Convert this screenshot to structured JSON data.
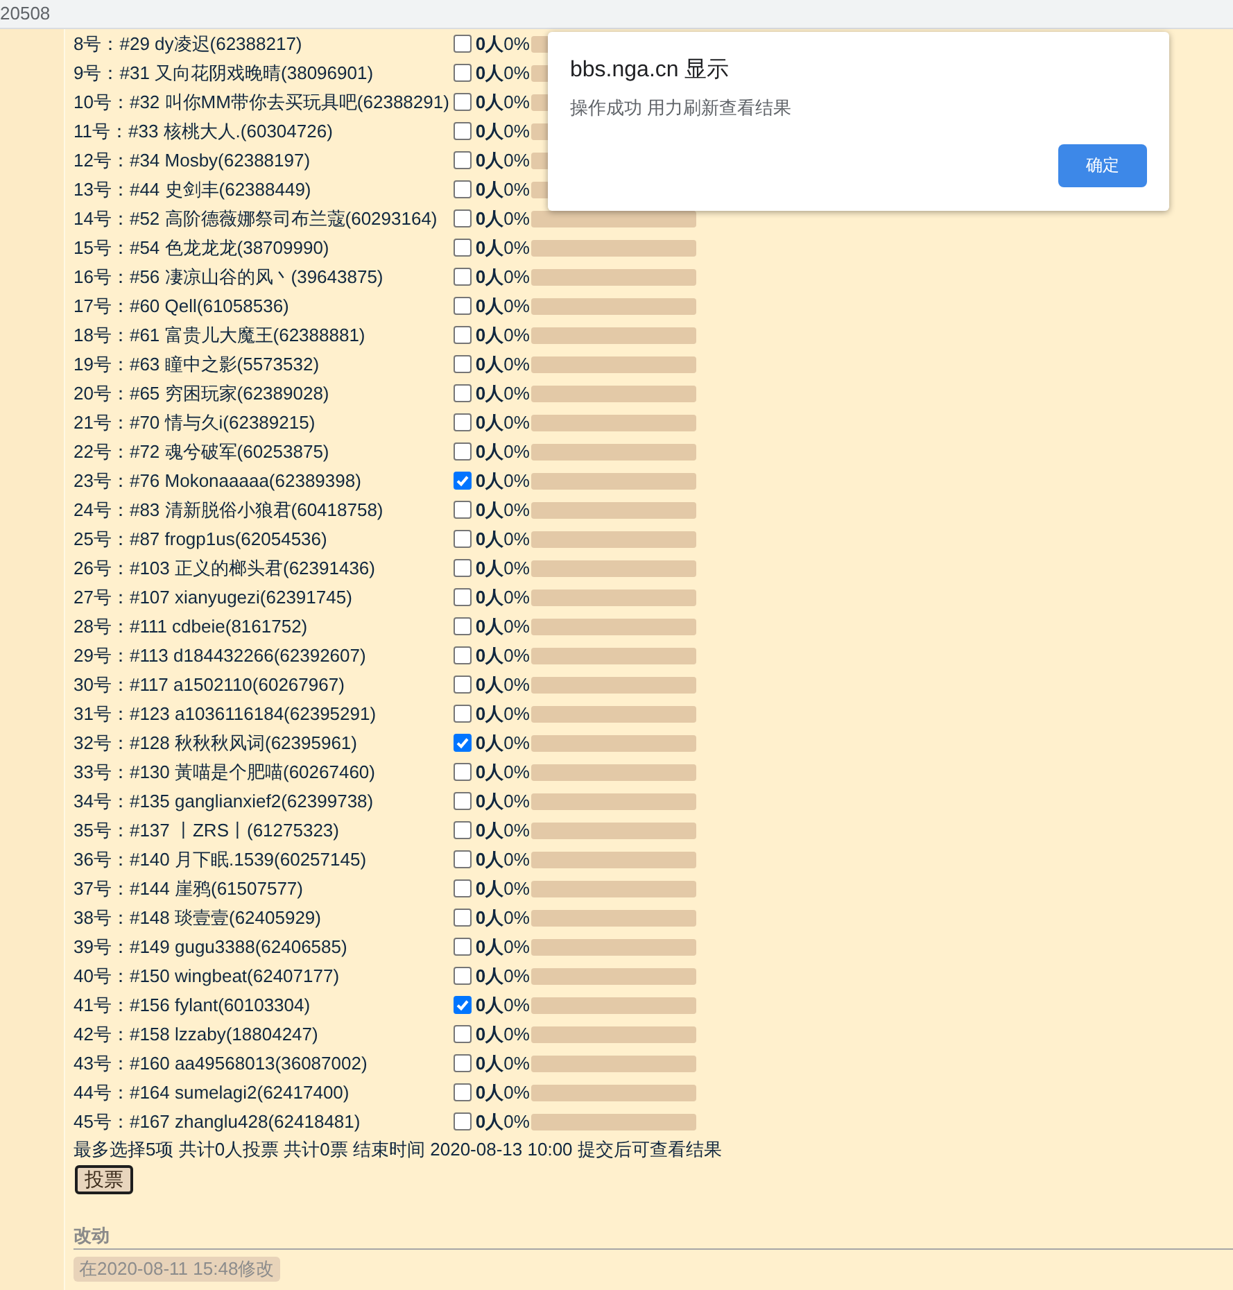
{
  "top_bar": {
    "text": "20508"
  },
  "poll": {
    "options": [
      {
        "label": "8号：#29 dy凌迟(62388217)",
        "checked": false,
        "votes": "0人",
        "percent": "0%",
        "level": 0
      },
      {
        "label": "9号：#31 又向花阴戏晚晴(38096901)",
        "checked": false,
        "votes": "0人",
        "percent": "0%",
        "level": 0
      },
      {
        "label": "10号：#32 叫你MM带你去买玩具吧(62388291)",
        "checked": false,
        "votes": "0人",
        "percent": "0%",
        "level": 0
      },
      {
        "label": "11号：#33 核桃大人.(60304726)",
        "checked": false,
        "votes": "0人",
        "percent": "0%",
        "level": 0
      },
      {
        "label": "12号：#34 Mosby(62388197)",
        "checked": false,
        "votes": "0人",
        "percent": "0%",
        "level": 0
      },
      {
        "label": "13号：#44 史剑丰(62388449)",
        "checked": false,
        "votes": "0人",
        "percent": "0%",
        "level": 0
      },
      {
        "label": "14号：#52 高阶德薇娜祭司布兰蔻(60293164)",
        "checked": false,
        "votes": "0人",
        "percent": "0%",
        "level": 0
      },
      {
        "label": "15号：#54 色龙龙龙(38709990)",
        "checked": false,
        "votes": "0人",
        "percent": "0%",
        "level": 0
      },
      {
        "label": "16号：#56 凄凉山谷的风丶(39643875)",
        "checked": false,
        "votes": "0人",
        "percent": "0%",
        "level": 0
      },
      {
        "label": "17号：#60 Qell(61058536)",
        "checked": false,
        "votes": "0人",
        "percent": "0%",
        "level": 0
      },
      {
        "label": "18号：#61 富贵儿大魔王(62388881)",
        "checked": false,
        "votes": "0人",
        "percent": "0%",
        "level": 0
      },
      {
        "label": "19号：#63 瞳中之影(5573532)",
        "checked": false,
        "votes": "0人",
        "percent": "0%",
        "level": 0
      },
      {
        "label": "20号：#65 穷困玩家(62389028)",
        "checked": false,
        "votes": "0人",
        "percent": "0%",
        "level": 0
      },
      {
        "label": "21号：#70 情与久i(62389215)",
        "checked": false,
        "votes": "0人",
        "percent": "0%",
        "level": 0
      },
      {
        "label": "22号：#72 魂兮破军(60253875)",
        "checked": false,
        "votes": "0人",
        "percent": "0%",
        "level": 0
      },
      {
        "label": "23号：#76 Mokonaaaaa(62389398)",
        "checked": true,
        "votes": "0人",
        "percent": "0%",
        "level": 0
      },
      {
        "label": "24号：#83 清新脱俗小狼君(60418758)",
        "checked": false,
        "votes": "0人",
        "percent": "0%",
        "level": 0
      },
      {
        "label": "25号：#87 frogp1us(62054536)",
        "checked": false,
        "votes": "0人",
        "percent": "0%",
        "level": 0
      },
      {
        "label": "26号：#103 正义的榔头君(62391436)",
        "checked": false,
        "votes": "0人",
        "percent": "0%",
        "level": 0
      },
      {
        "label": "27号：#107 xianyugezi(62391745)",
        "checked": false,
        "votes": "0人",
        "percent": "0%",
        "level": 0
      },
      {
        "label": "28号：#111 cdbeie(8161752)",
        "checked": false,
        "votes": "0人",
        "percent": "0%",
        "level": 0
      },
      {
        "label": "29号：#113 d184432266(62392607)",
        "checked": false,
        "votes": "0人",
        "percent": "0%",
        "level": 0
      },
      {
        "label": "30号：#117 a1502110(60267967)",
        "checked": false,
        "votes": "0人",
        "percent": "0%",
        "level": 0
      },
      {
        "label": "31号：#123 a1036116184(62395291)",
        "checked": false,
        "votes": "0人",
        "percent": "0%",
        "level": 0
      },
      {
        "label": "32号：#128 秋秋秋风词(62395961)",
        "checked": true,
        "votes": "0人",
        "percent": "0%",
        "level": 0
      },
      {
        "label": "33号：#130 黃喵是个肥喵(60267460)",
        "checked": false,
        "votes": "0人",
        "percent": "0%",
        "level": 0
      },
      {
        "label": "34号：#135 ganglianxief2(62399738)",
        "checked": false,
        "votes": "0人",
        "percent": "0%",
        "level": 0
      },
      {
        "label": "35号：#137 丨ZRS丨(61275323)",
        "checked": false,
        "votes": "0人",
        "percent": "0%",
        "level": 0
      },
      {
        "label": "36号：#140 月下眠.1539(60257145)",
        "checked": false,
        "votes": "0人",
        "percent": "0%",
        "level": 0
      },
      {
        "label": "37号：#144 崖鸦(61507577)",
        "checked": false,
        "votes": "0人",
        "percent": "0%",
        "level": 0
      },
      {
        "label": "38号：#148 琰壹壹(62405929)",
        "checked": false,
        "votes": "0人",
        "percent": "0%",
        "level": 0
      },
      {
        "label": "39号：#149 gugu3388(62406585)",
        "checked": false,
        "votes": "0人",
        "percent": "0%",
        "level": 0
      },
      {
        "label": "40号：#150 wingbeat(62407177)",
        "checked": false,
        "votes": "0人",
        "percent": "0%",
        "level": 0
      },
      {
        "label": "41号：#156 fylant(60103304)",
        "checked": true,
        "votes": "0人",
        "percent": "0%",
        "level": 0
      },
      {
        "label": "42号：#158 lzzaby(18804247)",
        "checked": false,
        "votes": "0人",
        "percent": "0%",
        "level": 0
      },
      {
        "label": "43号：#160 aa49568013(36087002)",
        "checked": false,
        "votes": "0人",
        "percent": "0%",
        "level": 0
      },
      {
        "label": "44号：#164 sumelagi2(62417400)",
        "checked": false,
        "votes": "0人",
        "percent": "0%",
        "level": 0
      },
      {
        "label": "45号：#167 zhanglu428(62418481)",
        "checked": false,
        "votes": "0人",
        "percent": "0%",
        "level": 0
      }
    ],
    "summary": "最多选择5项 共计0人投票 共计0票 结束时间 2020-08-13 10:00 提交后可查看结果",
    "vote_button": "投票"
  },
  "edit_section": {
    "heading": "改动",
    "note": "在2020-08-11 15:48修改"
  },
  "dialog": {
    "title": "bbs.nga.cn 显示",
    "message": "操作成功 用力刷新查看结果",
    "button": "确定"
  }
}
